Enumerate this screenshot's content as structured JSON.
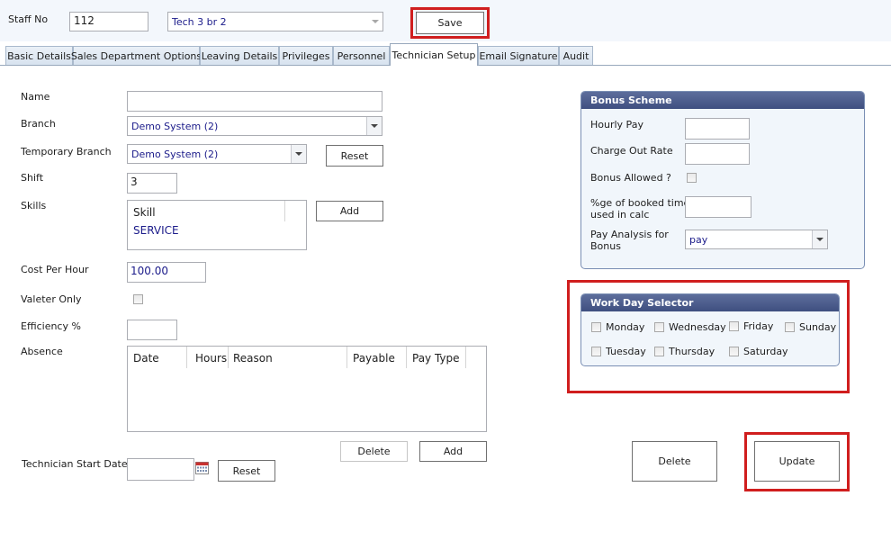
{
  "header": {
    "staff_no_label": "Staff No",
    "staff_no_value": "112",
    "staff_select_value": "Tech 3 br 2",
    "save_label": "Save"
  },
  "tabs": [
    {
      "label": "Basic Details"
    },
    {
      "label": "Sales Department Options"
    },
    {
      "label": "Leaving Details"
    },
    {
      "label": "Privileges"
    },
    {
      "label": "Personnel"
    },
    {
      "label": "Technician Setup",
      "active": true
    },
    {
      "label": "Email Signature"
    },
    {
      "label": "Audit"
    }
  ],
  "form": {
    "name_label": "Name",
    "name_value": "",
    "branch_label": "Branch",
    "branch_value": "Demo System (2)",
    "temp_branch_label": "Temporary Branch",
    "temp_branch_value": "Demo System (2)",
    "reset_label": "Reset",
    "shift_label": "Shift",
    "shift_value": "3",
    "skills_label": "Skills",
    "skills_header": "Skill",
    "skills_items": [
      "SERVICE"
    ],
    "add_label": "Add",
    "cost_label": "Cost Per Hour",
    "cost_value": "100.00",
    "valeter_label": "Valeter Only",
    "efficiency_label": "Efficiency %",
    "efficiency_value": "",
    "absence_label": "Absence",
    "absence_columns": [
      "Date",
      "Hours",
      "Reason",
      "Payable",
      "Pay Type"
    ],
    "absence_delete_label": "Delete",
    "absence_add_label": "Add",
    "start_date_label": "Technician Start Date",
    "start_date_value": "",
    "start_reset_label": "Reset"
  },
  "bonus": {
    "title": "Bonus Scheme",
    "hourly_pay_label": "Hourly Pay",
    "charge_out_label": "Charge Out Rate",
    "bonus_allowed_label": "Bonus Allowed ?",
    "booked_time_label_1": "%ge of booked time",
    "booked_time_label_2": "used in calc",
    "pay_analysis_label_1": "Pay Analysis for",
    "pay_analysis_label_2": "Bonus",
    "pay_analysis_value": "pay"
  },
  "workday": {
    "title": "Work Day Selector",
    "days": [
      "Monday",
      "Wednesday",
      "Friday",
      "Sunday",
      "Tuesday",
      "Thursday",
      "Saturday"
    ]
  },
  "actions": {
    "delete_label": "Delete",
    "update_label": "Update"
  },
  "colors": {
    "highlight": "#d01e1e",
    "panel_header": "#4a5a8a",
    "value_text": "#1b1b8a"
  }
}
